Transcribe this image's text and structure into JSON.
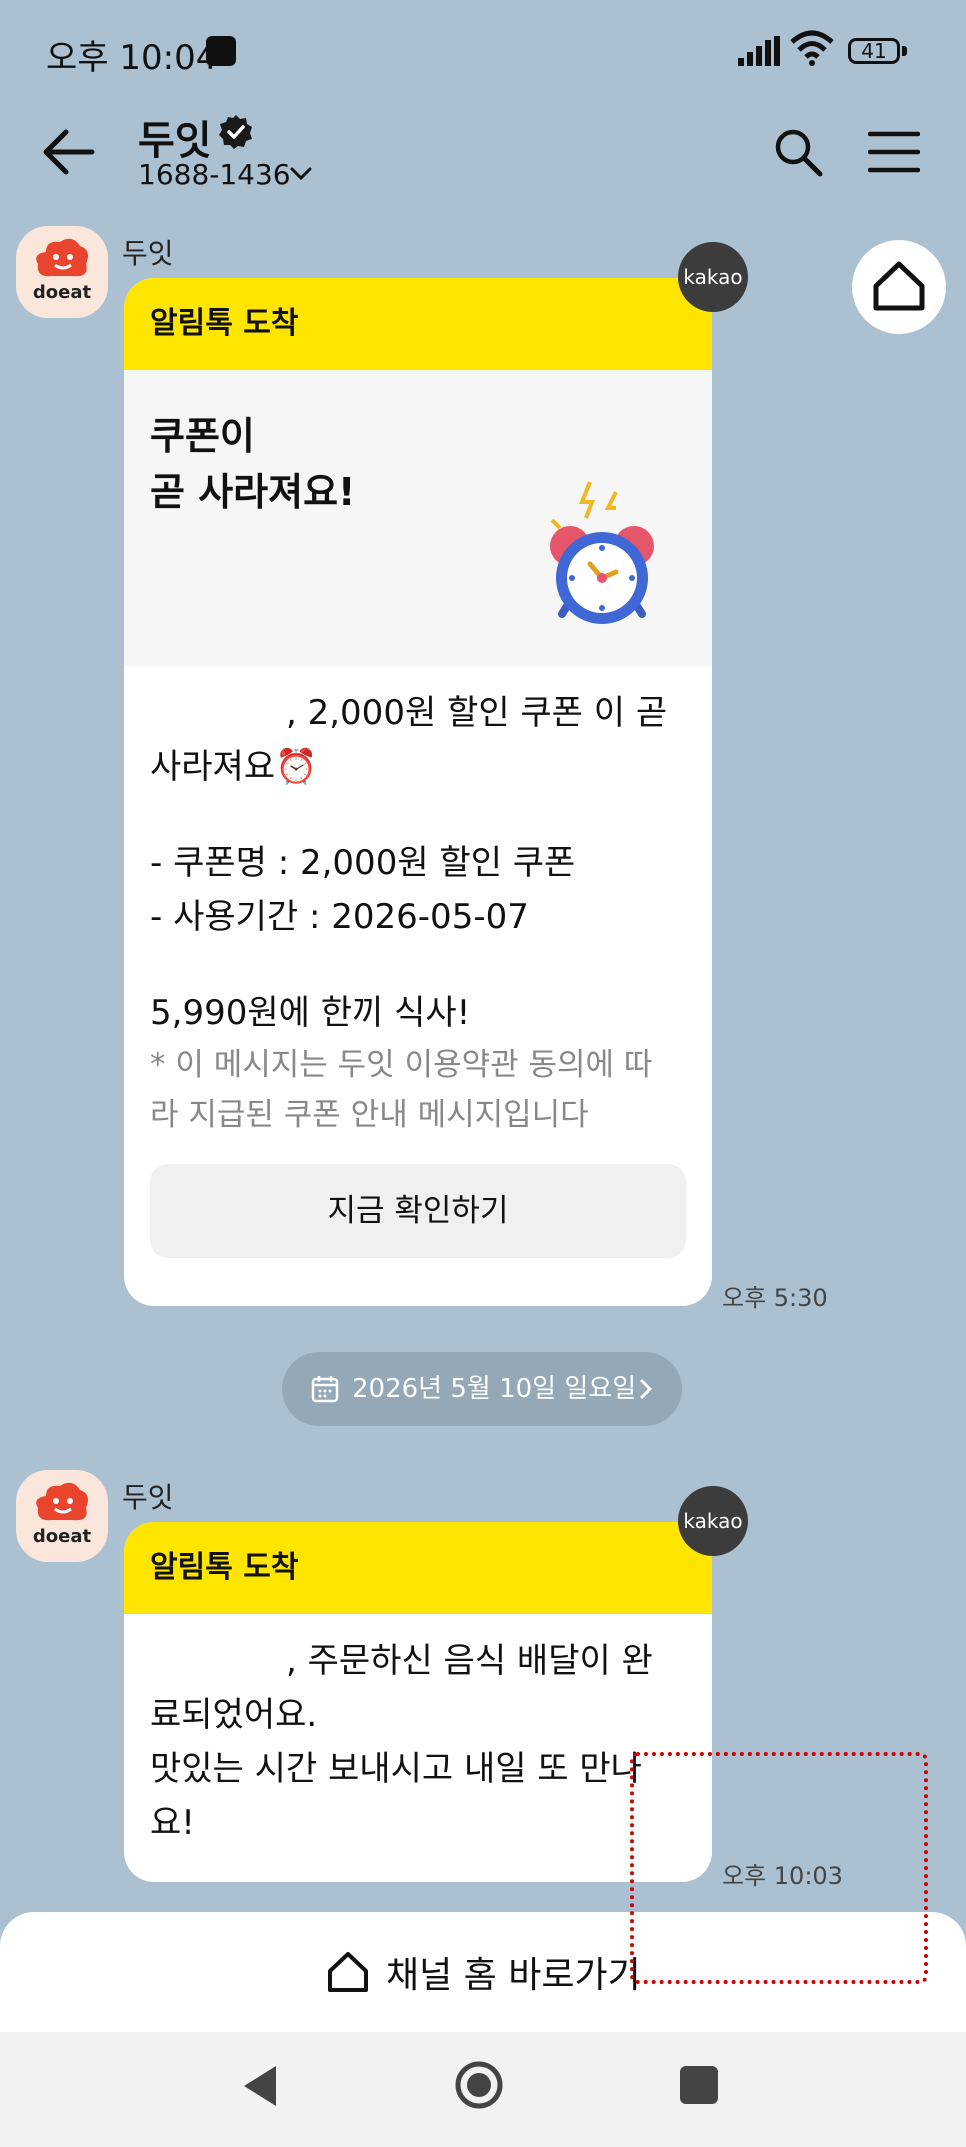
{
  "status_bar": {
    "time": "오후 10:04",
    "battery": "41"
  },
  "header": {
    "channel_name": "두잇",
    "phone": "1688-1436"
  },
  "messages": [
    {
      "sender": "두잇",
      "badge": "kakao",
      "header_label": "알림톡 도착",
      "title_line1": "쿠폰이",
      "title_line2": "곧 사라져요!",
      "line1": ", 2,000원 할인 쿠폰 이 곧",
      "line2": "사라져요⏰",
      "line3": "- 쿠폰명 : 2,000원 할인 쿠폰",
      "line4": "- 사용기간 : 2026-05-07",
      "line5": "5,990원에 한끼 식사!",
      "note1": "* 이 메시지는 두잇 이용약관 동의에 따",
      "note2": "라 지급된 쿠폰 안내 메시지입니다",
      "button": "지금 확인하기",
      "time": "오후 5:30"
    },
    {
      "sender": "두잇",
      "badge": "kakao",
      "header_label": "알림톡 도착",
      "line1": ", 주문하신 음식 배달이 완",
      "line2": "료되었어요.",
      "line3": "맛있는 시간 보내시고 내일 또 만나",
      "line4": "요!",
      "time": "오후 10:03"
    }
  ],
  "date_divider": "2026년 5월 10일 일요일",
  "footer": {
    "label": "채널 홈 바로가기"
  },
  "avatar_logo": "doeat",
  "colors": {
    "background": "#abc1d1",
    "accent_yellow": "#fee500",
    "logo_red": "#e8442e",
    "highlight_red": "#d10000"
  },
  "icons": [
    "back-arrow-icon",
    "verified-icon",
    "chevron-down-icon",
    "search-icon",
    "menu-icon",
    "home-icon",
    "alarm-clock-icon",
    "calendar-icon",
    "chevron-right-icon"
  ]
}
